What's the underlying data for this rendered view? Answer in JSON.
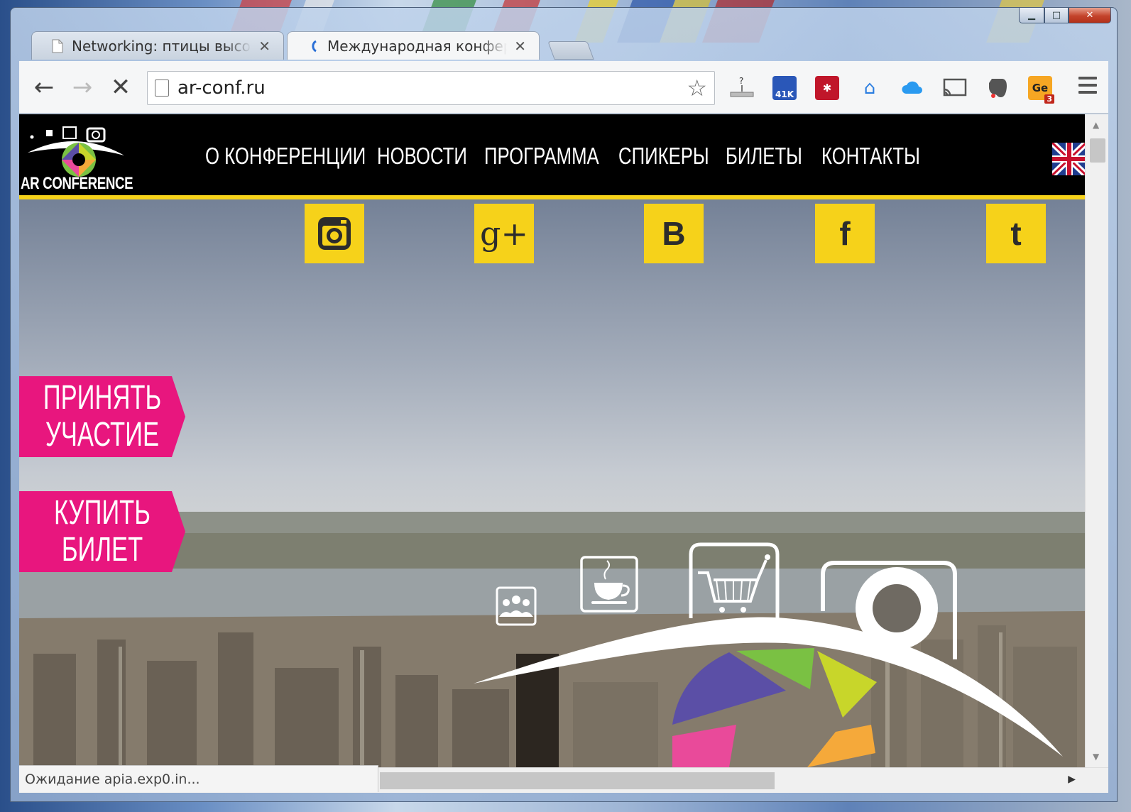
{
  "browser": {
    "tabs": [
      {
        "title": "Networking: птицы высо",
        "state": "inactive"
      },
      {
        "title": "Международная конфер",
        "state": "active"
      }
    ],
    "url": "ar-conf.ru",
    "extensions": [
      {
        "name": "download-icon",
        "label": ""
      },
      {
        "name": "translate-41k-extension",
        "label": "41K"
      },
      {
        "name": "lastpass-extension",
        "label": ""
      },
      {
        "name": "home-extension",
        "label": ""
      },
      {
        "name": "cloud-extension",
        "label": ""
      },
      {
        "name": "cast-icon",
        "label": ""
      },
      {
        "name": "evernote-icon",
        "label": ""
      },
      {
        "name": "ge-extension",
        "label": "Ge",
        "badge": "3"
      }
    ],
    "status": "Ожидание apia.exp0.in..."
  },
  "site": {
    "logo_text": "AR CONFERENCE",
    "nav": [
      "О КОНФЕРЕНЦИИ",
      "НОВОСТИ",
      "ПРОГРАММА",
      "СПИКЕРЫ",
      "БИЛЕТЫ",
      "КОНТАКТЫ"
    ],
    "social": [
      {
        "name": "instagram-icon",
        "glyph": ""
      },
      {
        "name": "google-plus-icon",
        "glyph": "g+"
      },
      {
        "name": "vk-icon",
        "glyph": "В"
      },
      {
        "name": "facebook-icon",
        "glyph": "f"
      },
      {
        "name": "twitter-icon",
        "glyph": "t"
      }
    ],
    "cta": {
      "participate": "ПРИНЯТЬ УЧАСТИЕ",
      "buy_ticket": "КУПИТЬ БИЛЕТ"
    }
  },
  "colors": {
    "accent_yellow": "#f6d21a",
    "cta_pink": "#e8167e",
    "header_black": "#000000"
  }
}
